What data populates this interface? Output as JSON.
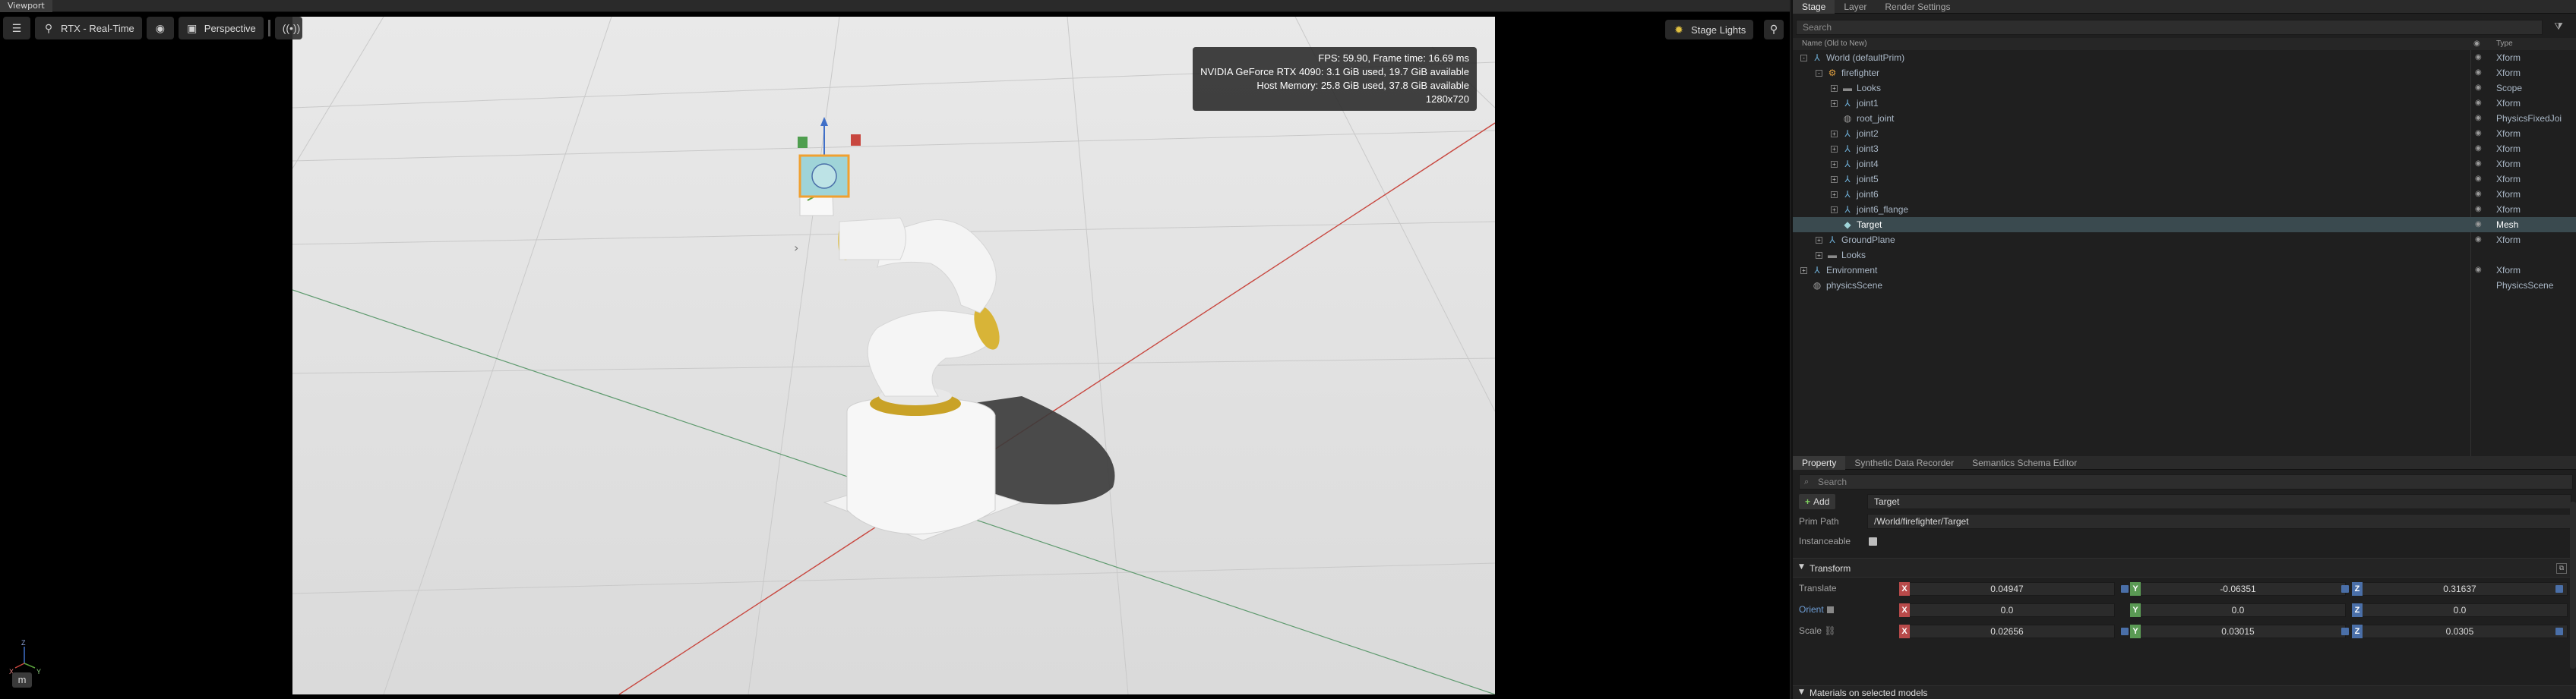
{
  "viewport": {
    "tab_label": "Viewport",
    "toolbar": {
      "renderer_label": "RTX - Real-Time",
      "camera_label": "Perspective"
    },
    "stats": {
      "line1": "FPS: 59.90, Frame time: 16.69 ms",
      "line2": "NVIDIA GeForce RTX 4090: 3.1 GiB used, 19.7 GiB available",
      "line3": "Host Memory: 25.8 GiB used, 37.8 GiB available",
      "line4": "1280x720"
    },
    "stage_lights_label": "Stage Lights",
    "unit_label": "m",
    "gizmo_axes": {
      "x": "X",
      "y": "Y",
      "z": "Z"
    },
    "colors": {
      "x_axis": "#c8473f",
      "y_axis": "#5aa03c",
      "z_axis": "#3f6fc8",
      "selection": "#f0a030"
    }
  },
  "stage": {
    "tabs": [
      "Stage",
      "Layer",
      "Render Settings"
    ],
    "search_placeholder": "Search",
    "header": {
      "name": "Name (Old to New)",
      "type": "Type"
    },
    "rows": [
      {
        "label": "World (defaultPrim)",
        "type": "Xform",
        "depth": 0,
        "expander": "-",
        "icon": "xform",
        "eye": true,
        "selected": false
      },
      {
        "label": "firefighter",
        "type": "Xform",
        "depth": 1,
        "expander": "-",
        "icon": "articulation",
        "eye": true,
        "selected": false
      },
      {
        "label": "Looks",
        "type": "Scope",
        "depth": 2,
        "expander": "+",
        "icon": "folder",
        "eye": true,
        "selected": false
      },
      {
        "label": "joint1",
        "type": "Xform",
        "depth": 2,
        "expander": "+",
        "icon": "xform",
        "eye": true,
        "selected": false
      },
      {
        "label": "root_joint",
        "type": "PhysicsFixedJoi",
        "depth": 2,
        "expander": "",
        "icon": "physics",
        "eye": true,
        "selected": false
      },
      {
        "label": "joint2",
        "type": "Xform",
        "depth": 2,
        "expander": "+",
        "icon": "xform",
        "eye": true,
        "selected": false
      },
      {
        "label": "joint3",
        "type": "Xform",
        "depth": 2,
        "expander": "+",
        "icon": "xform",
        "eye": true,
        "selected": false
      },
      {
        "label": "joint4",
        "type": "Xform",
        "depth": 2,
        "expander": "+",
        "icon": "xform",
        "eye": true,
        "selected": false
      },
      {
        "label": "joint5",
        "type": "Xform",
        "depth": 2,
        "expander": "+",
        "icon": "xform",
        "eye": true,
        "selected": false
      },
      {
        "label": "joint6",
        "type": "Xform",
        "depth": 2,
        "expander": "+",
        "icon": "xform",
        "eye": true,
        "selected": false
      },
      {
        "label": "joint6_flange",
        "type": "Xform",
        "depth": 2,
        "expander": "+",
        "icon": "xform",
        "eye": true,
        "selected": false
      },
      {
        "label": "Target",
        "type": "Mesh",
        "depth": 2,
        "expander": "",
        "icon": "mesh",
        "eye": true,
        "selected": true
      },
      {
        "label": "GroundPlane",
        "type": "Xform",
        "depth": 1,
        "expander": "+",
        "icon": "xform",
        "eye": true,
        "selected": false
      },
      {
        "label": "Looks",
        "type": "",
        "depth": 1,
        "expander": "+",
        "icon": "folder",
        "eye": false,
        "selected": false
      },
      {
        "label": "Environment",
        "type": "Xform",
        "depth": 0,
        "expander": "+",
        "icon": "xform",
        "eye": true,
        "selected": false
      },
      {
        "label": "physicsScene",
        "type": "PhysicsScene",
        "depth": 0,
        "expander": "",
        "icon": "physics",
        "eye": false,
        "selected": false
      }
    ]
  },
  "property": {
    "tabs": [
      "Property",
      "Synthetic Data Recorder",
      "Semantics Schema Editor"
    ],
    "search_placeholder": "Search",
    "add_label": "Add",
    "name_value": "Target",
    "prim_path_label": "Prim Path",
    "prim_path_value": "/World/firefighter/Target",
    "instanceable_label": "Instanceable",
    "transform_section": "Transform",
    "translate": {
      "label": "Translate",
      "x": "0.04947",
      "y": "-0.06351",
      "z": "0.31637"
    },
    "orient": {
      "label": "Orient",
      "x": "0.0",
      "y": "0.0",
      "z": "0.0"
    },
    "scale": {
      "label": "Scale",
      "x": "0.02656",
      "y": "0.03015",
      "z": "0.0305"
    },
    "axis_letters": {
      "x": "X",
      "y": "Y",
      "z": "Z"
    },
    "materials_section": "Materials on selected models"
  }
}
